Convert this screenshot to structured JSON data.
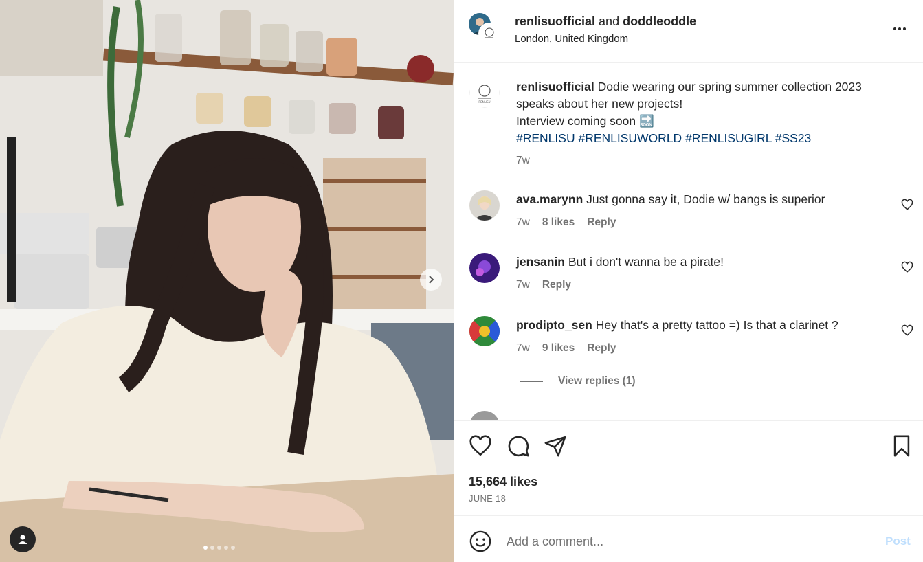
{
  "post": {
    "photo_alt": "",
    "carousel": {
      "count": 5,
      "current": 1
    }
  },
  "header": {
    "user1": "renlisuofficial",
    "joiner": "and",
    "user2": "doddleoddle",
    "location": "London, United Kingdom"
  },
  "caption": {
    "username": "renlisuofficial",
    "text_line1": "Dodie wearing our spring summer collection 2023 speaks about her new projects!",
    "text_line2": "Interview coming soon",
    "soon_emoji": "🔜",
    "hashtags": [
      "#RENLISU",
      "#RENLISUWORLD",
      "#RENLISUGIRL",
      "#SS23"
    ],
    "time": "7w"
  },
  "comments": [
    {
      "username": "ava.marynn",
      "text": "Just gonna say it, Dodie w/ bangs is superior",
      "time": "7w",
      "likes": "8 likes",
      "reply": "Reply"
    },
    {
      "username": "jensanin",
      "text": "But i don't wanna be a pirate!",
      "time": "7w",
      "likes": "",
      "reply": "Reply"
    },
    {
      "username": "prodipto_sen",
      "text": "Hey that's a pretty tattoo =) Is that a clarinet ?",
      "time": "7w",
      "likes": "9 likes",
      "reply": "Reply"
    }
  ],
  "view_replies": "View replies (1)",
  "stats": {
    "likes": "15,664 likes",
    "date": "JUNE 18"
  },
  "add_comment": {
    "placeholder": "Add a comment...",
    "post_label": "Post"
  },
  "colors": {
    "link": "#00376b",
    "muted": "#737373",
    "post_disabled": "#c0dffd",
    "text": "#262626"
  }
}
